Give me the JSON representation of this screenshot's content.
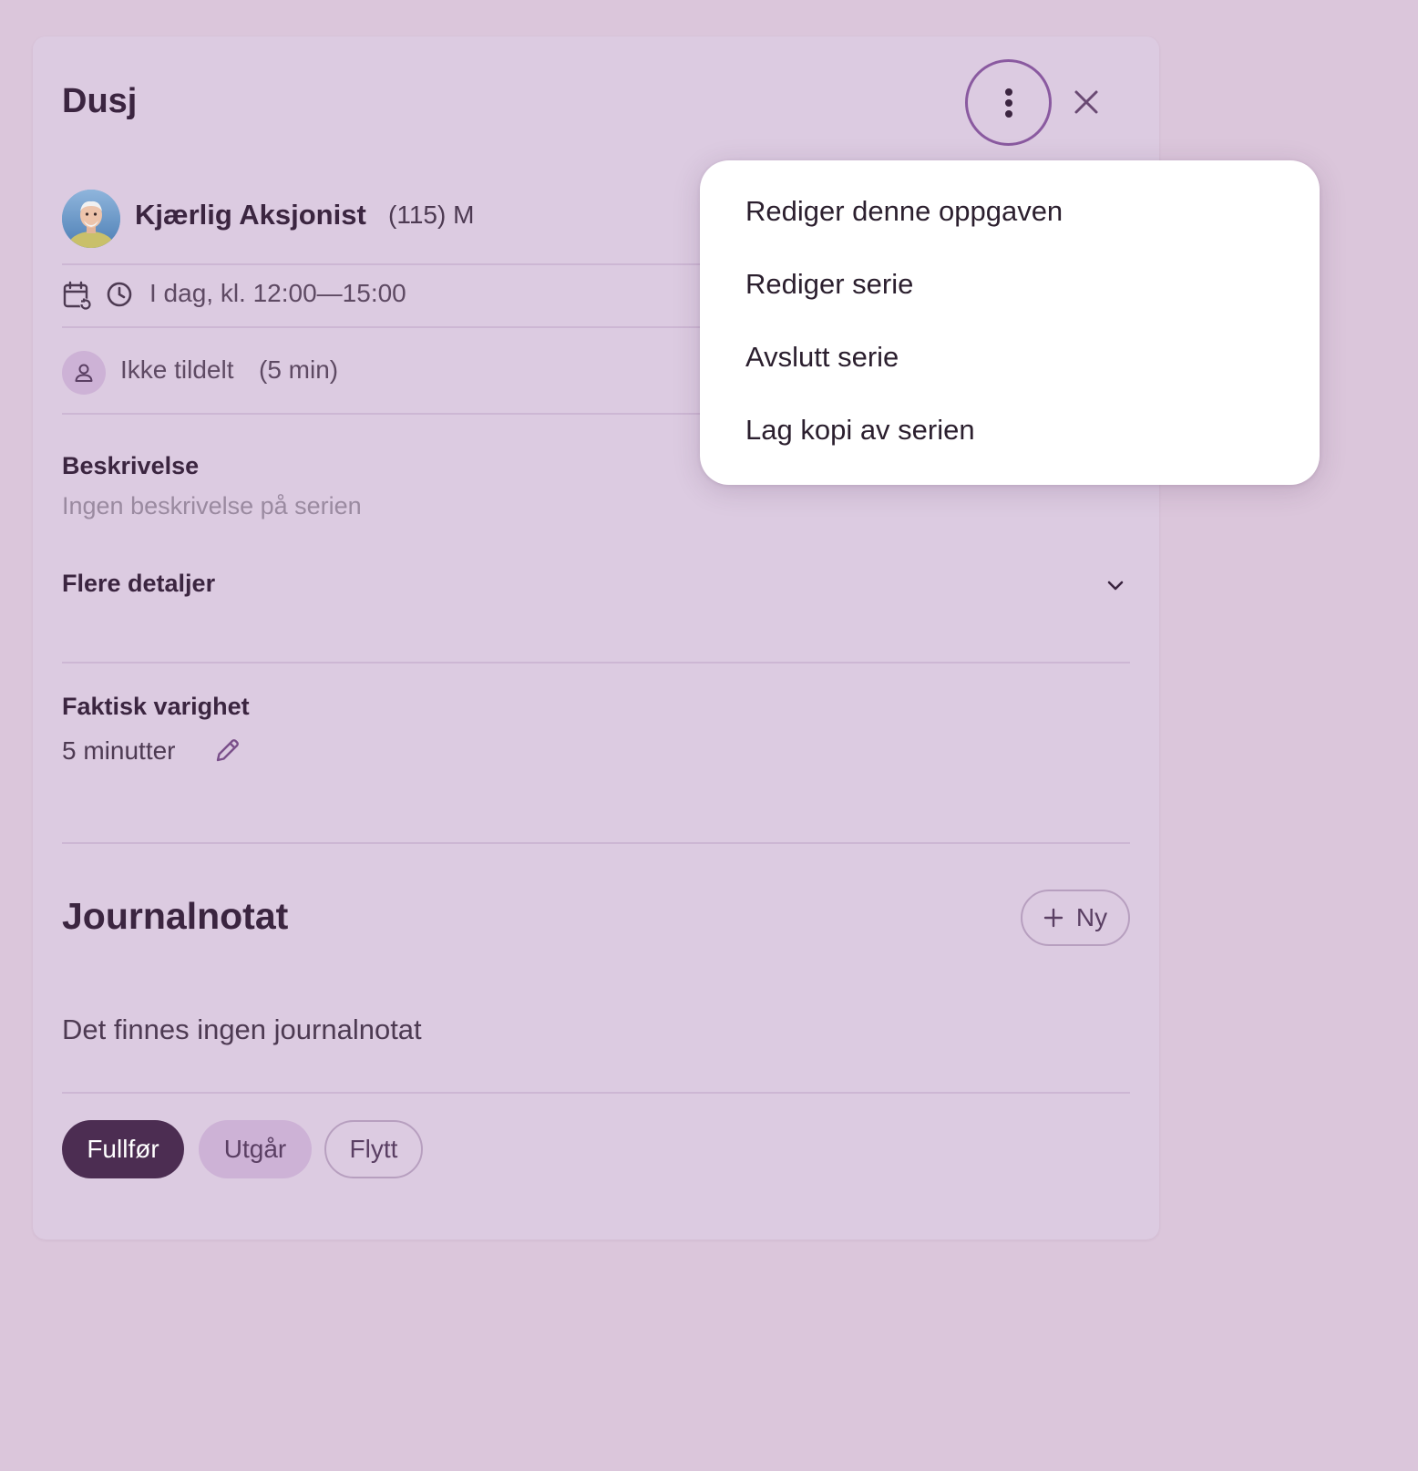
{
  "task": {
    "title": "Dusj"
  },
  "patient": {
    "name": "Kjærlig Aksjonist",
    "meta": "(115) M"
  },
  "schedule": {
    "time_text": "I dag, kl. 12:00—15:00"
  },
  "assignment": {
    "assignee": "Ikke tildelt",
    "duration": "(5 min)"
  },
  "description": {
    "label": "Beskrivelse",
    "value": "Ingen beskrivelse på serien"
  },
  "more_details": {
    "label": "Flere detaljer"
  },
  "actual_duration": {
    "label": "Faktisk varighet",
    "value": "5 minutter"
  },
  "journal": {
    "title": "Journalnotat",
    "new_button": "Ny",
    "empty_text": "Det finnes ingen journalnotat"
  },
  "actions": {
    "complete": "Fullfør",
    "cancel": "Utgår",
    "move": "Flytt"
  },
  "menu": {
    "items": [
      "Rediger denne oppgaven",
      "Rediger serie",
      "Avslutt serie",
      "Lag kopi av serien"
    ]
  },
  "colors": {
    "background": "#dbc6db",
    "panel": "#dccbe1",
    "primary": "#4c2d52",
    "accent": "#8a5aa0"
  }
}
